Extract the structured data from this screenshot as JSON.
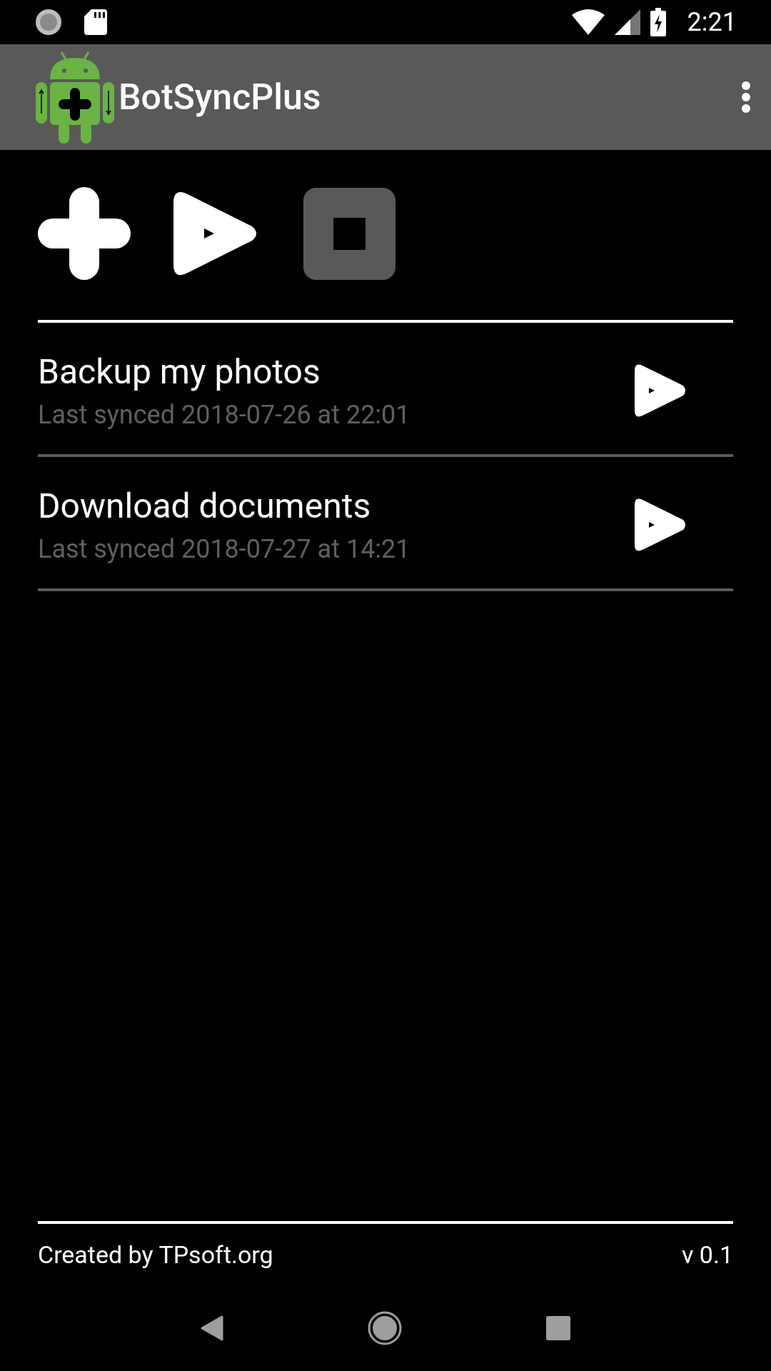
{
  "status_bar": {
    "time": "2:21"
  },
  "app_bar": {
    "title": "BotSyncPlus"
  },
  "toolbar": [
    {
      "kind": "add",
      "disabled": false
    },
    {
      "kind": "play",
      "disabled": false
    },
    {
      "kind": "stop",
      "disabled": true
    }
  ],
  "tasks": [
    {
      "name": "Backup my photos",
      "last_synced": "Last synced 2018-07-26 at 22:01"
    },
    {
      "name": "Download documents",
      "last_synced": "Last synced 2018-07-27 at 14:21"
    }
  ],
  "footer": {
    "credit": "Created by TPsoft.org",
    "version": "v 0.1"
  }
}
